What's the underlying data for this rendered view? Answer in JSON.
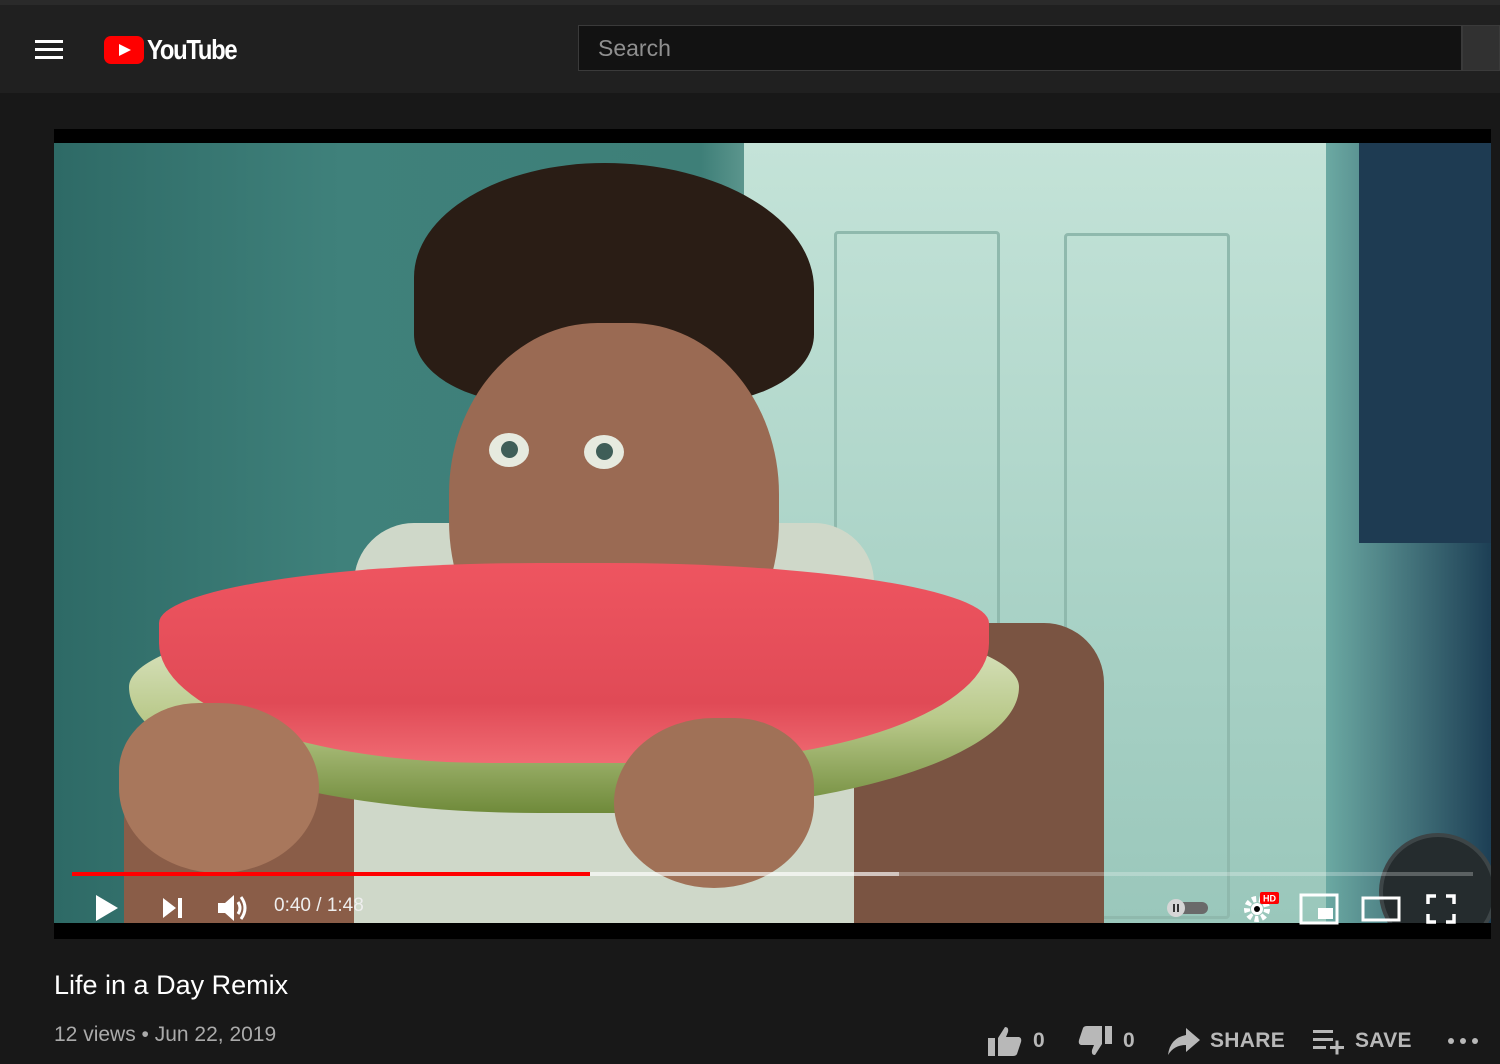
{
  "masthead": {
    "logo_text": "YouTube",
    "search_placeholder": "Search"
  },
  "player": {
    "current_time": "0:40",
    "duration": "1:48",
    "time_display": "0:40 / 1:48",
    "played_fraction": 0.37,
    "buffered_fraction": 0.59,
    "settings_badge": "HD",
    "autoplay_on": false
  },
  "video": {
    "title": "Life in a Day Remix",
    "views": "12 views",
    "date": "Jun 22, 2019",
    "meta_line": "12 views • Jun 22, 2019"
  },
  "actions": {
    "like_count": "0",
    "dislike_count": "0",
    "share_label": "SHARE",
    "save_label": "SAVE"
  },
  "colors": {
    "accent": "#ff0000",
    "background": "#181818",
    "masthead": "#202020"
  }
}
